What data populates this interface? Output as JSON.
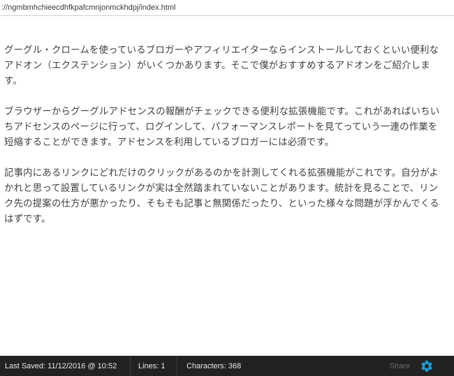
{
  "urlbar": {
    "url": "://ngmbmhchieecdhfkpafcmnjonmckhdpj/index.html"
  },
  "editor": {
    "paragraphs": [
      "グーグル・クロームを使っているブロガーやアフィリエイターならインストールしておくといい便利なアドオン（エクステンション）がいくつかあります。そこで僕がおすすめするアドオンをご紹介します。",
      "ブラウザーからグーグルアドセンスの報酬がチェックできる便利な拡張機能です。これがあればいちいちアドセンスのページに行って、ログインして、パフォーマンスレポートを見てっていう一連の作業を短縮することができます。アドセンスを利用しているブロガーには必須です。",
      "記事内にあるリンクにどれだけのクリックがあるのかを計測してくれる拡張機能がこれです。自分がよかれと思って設置しているリンクが実は全然踏まれていないことがあります。統計を見ることで、リンク先の提案の仕方が悪かったり、そもそも記事と無関係だったり、といった様々な問題が浮かんでくるはずです。"
    ]
  },
  "statusbar": {
    "last_saved": "Last Saved: 11/12/2016 @ 10:52",
    "lines": "Lines: 1",
    "characters": "Characters: 368",
    "share_label": "Share",
    "gear_icon": "gear-icon",
    "gear_color": "#1a9ad6"
  }
}
